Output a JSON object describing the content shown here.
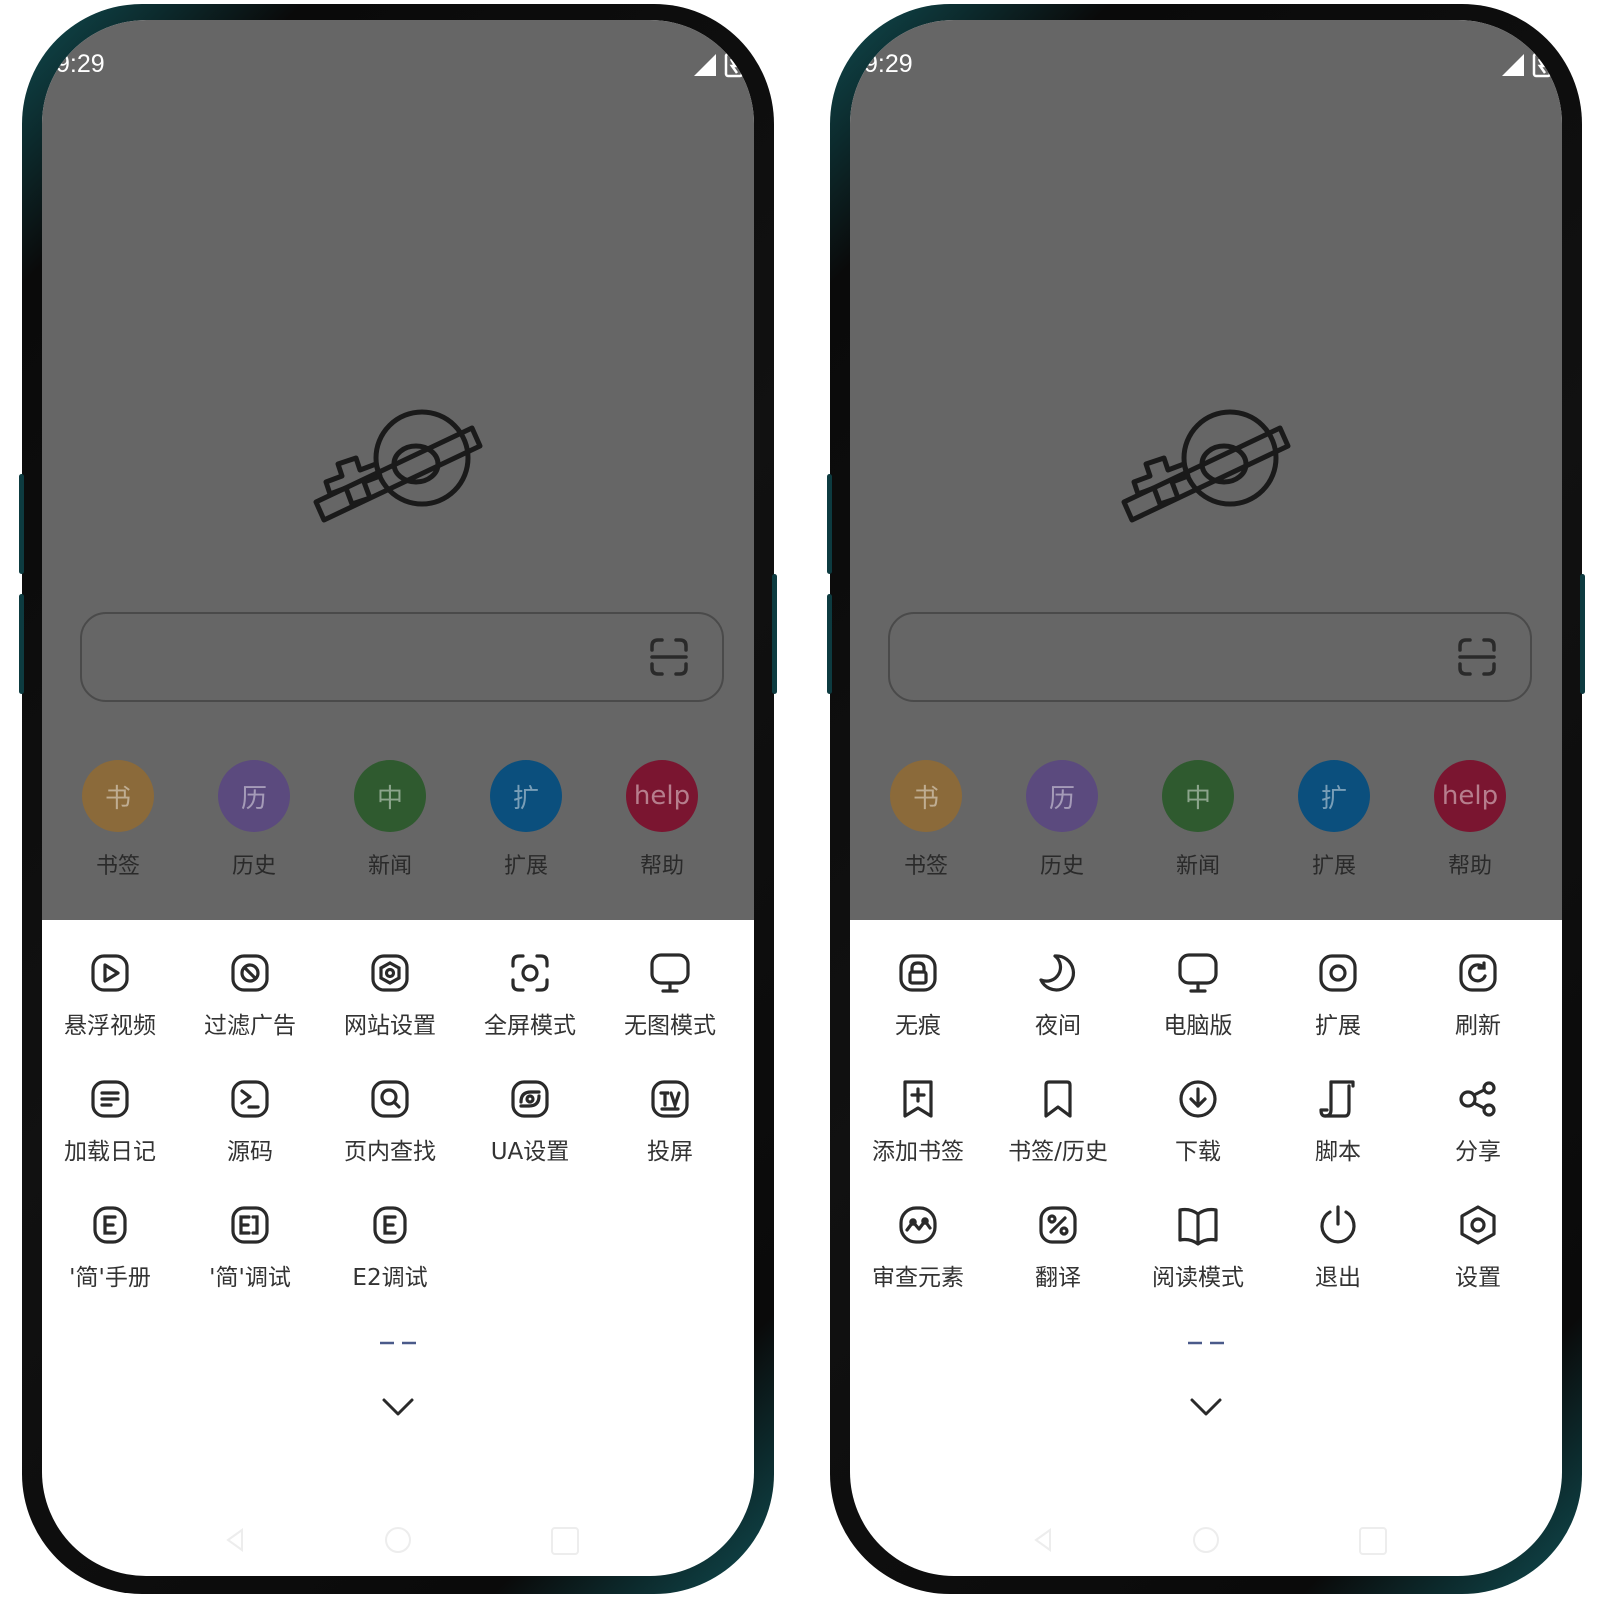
{
  "phones": [
    {
      "status_time": "9:29",
      "quick_links": [
        {
          "glyph": "书",
          "label": "书签",
          "color": "#8b6a3a"
        },
        {
          "glyph": "历",
          "label": "历史",
          "color": "#5b4a7e"
        },
        {
          "glyph": "中",
          "label": "新闻",
          "color": "#2f5a2f"
        },
        {
          "glyph": "扩",
          "label": "扩展",
          "color": "#0b4f7d"
        },
        {
          "glyph": "help",
          "label": "帮助",
          "color": "#7a1530"
        }
      ],
      "menu_items": [
        {
          "label": "悬浮视频",
          "icon": "play-icon"
        },
        {
          "label": "过滤广告",
          "icon": "block-icon"
        },
        {
          "label": "网站设置",
          "icon": "site-settings-icon"
        },
        {
          "label": "全屏模式",
          "icon": "fullscreen-icon"
        },
        {
          "label": "无图模式",
          "icon": "monitor-icon"
        },
        {
          "label": "加载日记",
          "icon": "log-icon"
        },
        {
          "label": "源码",
          "icon": "terminal-icon"
        },
        {
          "label": "页内查找",
          "icon": "search-icon"
        },
        {
          "label": "UA设置",
          "icon": "ua-icon"
        },
        {
          "label": "投屏",
          "icon": "tv-icon"
        },
        {
          "label": "'简'手册",
          "icon": "e-icon"
        },
        {
          "label": "'简'调试",
          "icon": "e-debug-icon"
        },
        {
          "label": "E2调试",
          "icon": "e2-icon"
        }
      ]
    },
    {
      "status_time": "9:29",
      "quick_links": [
        {
          "glyph": "书",
          "label": "书签",
          "color": "#8b6a3a"
        },
        {
          "glyph": "历",
          "label": "历史",
          "color": "#5b4a7e"
        },
        {
          "glyph": "中",
          "label": "新闻",
          "color": "#2f5a2f"
        },
        {
          "glyph": "扩",
          "label": "扩展",
          "color": "#0b4f7d"
        },
        {
          "glyph": "help",
          "label": "帮助",
          "color": "#7a1530"
        }
      ],
      "menu_items": [
        {
          "label": "无痕",
          "icon": "lock-icon"
        },
        {
          "label": "夜间",
          "icon": "moon-icon"
        },
        {
          "label": "电脑版",
          "icon": "monitor-icon"
        },
        {
          "label": "扩展",
          "icon": "extension-icon"
        },
        {
          "label": "刷新",
          "icon": "refresh-icon"
        },
        {
          "label": "添加书签",
          "icon": "add-bookmark-icon"
        },
        {
          "label": "书签/历史",
          "icon": "bookmark-icon"
        },
        {
          "label": "下载",
          "icon": "download-icon"
        },
        {
          "label": "脚本",
          "icon": "script-icon"
        },
        {
          "label": "分享",
          "icon": "share-icon"
        },
        {
          "label": "审查元素",
          "icon": "inspect-icon"
        },
        {
          "label": "翻译",
          "icon": "translate-icon"
        },
        {
          "label": "阅读模式",
          "icon": "book-icon"
        },
        {
          "label": "退出",
          "icon": "power-icon"
        },
        {
          "label": "设置",
          "icon": "settings-icon"
        }
      ]
    }
  ]
}
